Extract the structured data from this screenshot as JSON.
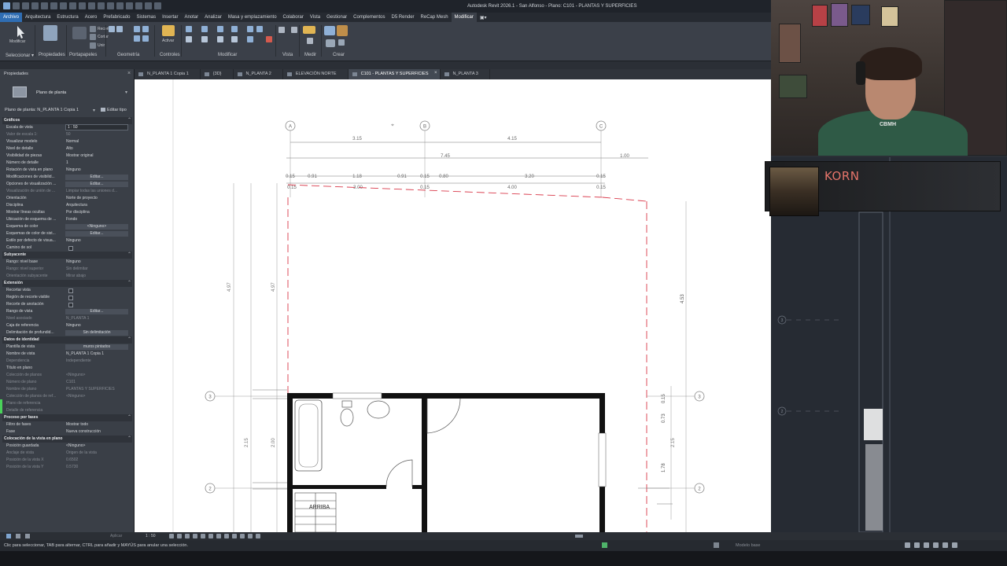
{
  "window": {
    "title": "Autodesk Revit 2026.1 - San Alfonso - Plano: C101 - PLANTAS Y SUPERFICIES"
  },
  "menu": [
    {
      "label": "Archivo"
    },
    {
      "label": "Arquitectura"
    },
    {
      "label": "Estructura"
    },
    {
      "label": "Acero"
    },
    {
      "label": "Prefabricado"
    },
    {
      "label": "Sistemas"
    },
    {
      "label": "Insertar"
    },
    {
      "label": "Anotar"
    },
    {
      "label": "Analizar"
    },
    {
      "label": "Masa y emplazamiento"
    },
    {
      "label": "Colaborar"
    },
    {
      "label": "Vista"
    },
    {
      "label": "Gestionar"
    },
    {
      "label": "Complementos"
    },
    {
      "label": "D5 Render"
    },
    {
      "label": "ReCap Mesh"
    },
    {
      "label": "Modificar"
    }
  ],
  "ribbon": {
    "select_label": "Seleccionar",
    "select_btn": "Modificar",
    "groups": {
      "propiedades": "Propiedades",
      "portapapeles": "Portapapeles",
      "geometria": "Geometría",
      "controles": "Controles",
      "modificar": "Modificar",
      "vista": "Vista",
      "medir": "Medir",
      "crear": "Crear"
    },
    "small": {
      "recorte": "Recorte",
      "cortar": "Cortar",
      "unir": "Unir",
      "activar": "Activar"
    }
  },
  "properties": {
    "title": "Propiedades",
    "type_name": "Plano de planta",
    "selector": "Plano de planta: N_PLANTA 1 Copia 1",
    "edit_type": "Editar tipo",
    "rows": [
      {
        "kind": "cat",
        "k": "Gráficos"
      },
      {
        "kind": "box",
        "k": "Escala de vista",
        "v": "1 : 50"
      },
      {
        "kind": "dis",
        "k": "Valor de escala    1:",
        "v": "50"
      },
      {
        "kind": "txt",
        "k": "Visualizar modelo",
        "v": "Normal"
      },
      {
        "kind": "txt",
        "k": "Nivel de detalle",
        "v": "Alto"
      },
      {
        "kind": "txt",
        "k": "Visibilidad de piezas",
        "v": "Mostrar original"
      },
      {
        "kind": "txt",
        "k": "Número de detalle",
        "v": "1"
      },
      {
        "kind": "txt",
        "k": "Rotación de vista en plano",
        "v": "Ninguno"
      },
      {
        "kind": "btn",
        "k": "Modificaciones de visibilid...",
        "v": "Editar..."
      },
      {
        "kind": "btn",
        "k": "Opciones de visualización ...",
        "v": "Editar..."
      },
      {
        "kind": "dis",
        "k": "Visualización de unión de ...",
        "v": "Limpiar todas las uniones d..."
      },
      {
        "kind": "txt",
        "k": "Orientación",
        "v": "Norte de proyecto"
      },
      {
        "kind": "txt",
        "k": "Disciplina",
        "v": "Arquitectura"
      },
      {
        "kind": "txt",
        "k": "Mostrar líneas ocultas",
        "v": "Por disciplina"
      },
      {
        "kind": "txt",
        "k": "Ubicación de esquema de ...",
        "v": "Fondo"
      },
      {
        "kind": "btn",
        "k": "Esquema de color",
        "v": "<Ninguno>"
      },
      {
        "kind": "btn",
        "k": "Esquemas de color de sist...",
        "v": "Editar..."
      },
      {
        "kind": "txt",
        "k": "Estilo por defecto de visua...",
        "v": "Ninguno"
      },
      {
        "kind": "chk",
        "k": "Camino de sol"
      },
      {
        "kind": "cat",
        "k": "Subyacente"
      },
      {
        "kind": "txt",
        "k": "Rango: nivel base",
        "v": "Ninguno"
      },
      {
        "kind": "dis",
        "k": "Rango: nivel superior",
        "v": "Sin delimitar"
      },
      {
        "kind": "dis",
        "k": "Orientación subyacente",
        "v": "Mirar abajo"
      },
      {
        "kind": "cat",
        "k": "Extensión"
      },
      {
        "kind": "chk",
        "k": "Recortar vista"
      },
      {
        "kind": "chk",
        "k": "Región de recorte visible"
      },
      {
        "kind": "chk",
        "k": "Recorte de anotación"
      },
      {
        "kind": "btn",
        "k": "Rango de vista",
        "v": "Editar..."
      },
      {
        "kind": "dis",
        "k": "Nivel asociado",
        "v": "N_PLANTA 1"
      },
      {
        "kind": "txt",
        "k": "Caja de referencia",
        "v": "Ninguno"
      },
      {
        "kind": "btn",
        "k": "Delimitación de profundid...",
        "v": "Sin delimitación"
      },
      {
        "kind": "cat",
        "k": "Datos de identidad"
      },
      {
        "kind": "btn",
        "k": "Plantilla de vista",
        "v": "muros pintados"
      },
      {
        "kind": "txt",
        "k": "Nombre de vista",
        "v": "N_PLANTA 1 Copia 1"
      },
      {
        "kind": "dis",
        "k": "Dependencia",
        "v": "Independiente"
      },
      {
        "kind": "txt",
        "k": "Título en plano",
        "v": ""
      },
      {
        "kind": "dis",
        "k": "Colección de planos",
        "v": "<Ninguno>"
      },
      {
        "kind": "dis",
        "k": "Número de plano",
        "v": "C101"
      },
      {
        "kind": "dis",
        "k": "Nombre de plano",
        "v": "PLANTAS Y SUPERFICIES"
      },
      {
        "kind": "dis",
        "k": "Colección de planos de ref...",
        "v": "<Ninguno>"
      },
      {
        "kind": "dis",
        "k": "Plano de referencia",
        "v": ""
      },
      {
        "kind": "dis",
        "k": "Detalle de referencia",
        "v": ""
      },
      {
        "kind": "cat",
        "k": "Proceso por fases"
      },
      {
        "kind": "txt",
        "k": "Filtro de fases",
        "v": "Mostrar todo"
      },
      {
        "kind": "txt",
        "k": "Fase",
        "v": "Nueva construcción"
      },
      {
        "kind": "cat",
        "k": "Colocación de la vista en plano"
      },
      {
        "kind": "txt",
        "k": "Posición guardada",
        "v": "<Ninguno>"
      },
      {
        "kind": "dis",
        "k": "Anclaje de vista",
        "v": "Origen de la vista"
      },
      {
        "kind": "dis",
        "k": "Posición de la vista X",
        "v": "0.6502"
      },
      {
        "kind": "dis",
        "k": "Posición de la vista Y",
        "v": "0.5730"
      }
    ],
    "apply": "Aplicar"
  },
  "tabs": [
    {
      "label": "N_PLANTA 1 Copia 1",
      "active": false
    },
    {
      "label": "{3D}",
      "active": false
    },
    {
      "label": "N_PLANTA 2",
      "active": false
    },
    {
      "label": "ELEVACIÓN NORTE",
      "active": false
    },
    {
      "label": "C101 - PLANTAS Y SUPERFICIES",
      "active": true
    },
    {
      "label": "N_PLANTA 3",
      "active": false
    }
  ],
  "drawing": {
    "grids": [
      "A",
      "B",
      "C"
    ],
    "levels": [
      "3",
      "2",
      "3",
      "2",
      "3",
      "2"
    ],
    "dims_top": [
      "3.15",
      "4.15",
      "7.45",
      "1.00"
    ],
    "dims_row": [
      "0.15",
      "0.91",
      "1.18",
      "0.91",
      "0.15",
      "0.80",
      "3.20",
      "0.15"
    ],
    "dims_row2": [
      "0.15",
      "3.00",
      "0.15",
      "4.00",
      "0.15"
    ],
    "dims_left": [
      "4.97",
      "4.97",
      "2.15",
      "2.00"
    ],
    "dims_right": [
      "4.53",
      "0.73",
      "0.15",
      "2.15",
      "1.78"
    ],
    "stair_label": "ARRIBA"
  },
  "music": {
    "artist": "KORN"
  },
  "viewbar": {
    "scale": "1 : 50"
  },
  "status": {
    "hint": "Clic para seleccionar, TAB para alternar, CTRL para añadir y MAYÚS para anular una selección.",
    "model": "Modelo base"
  },
  "webcam": {
    "shirt": "CBMH"
  }
}
